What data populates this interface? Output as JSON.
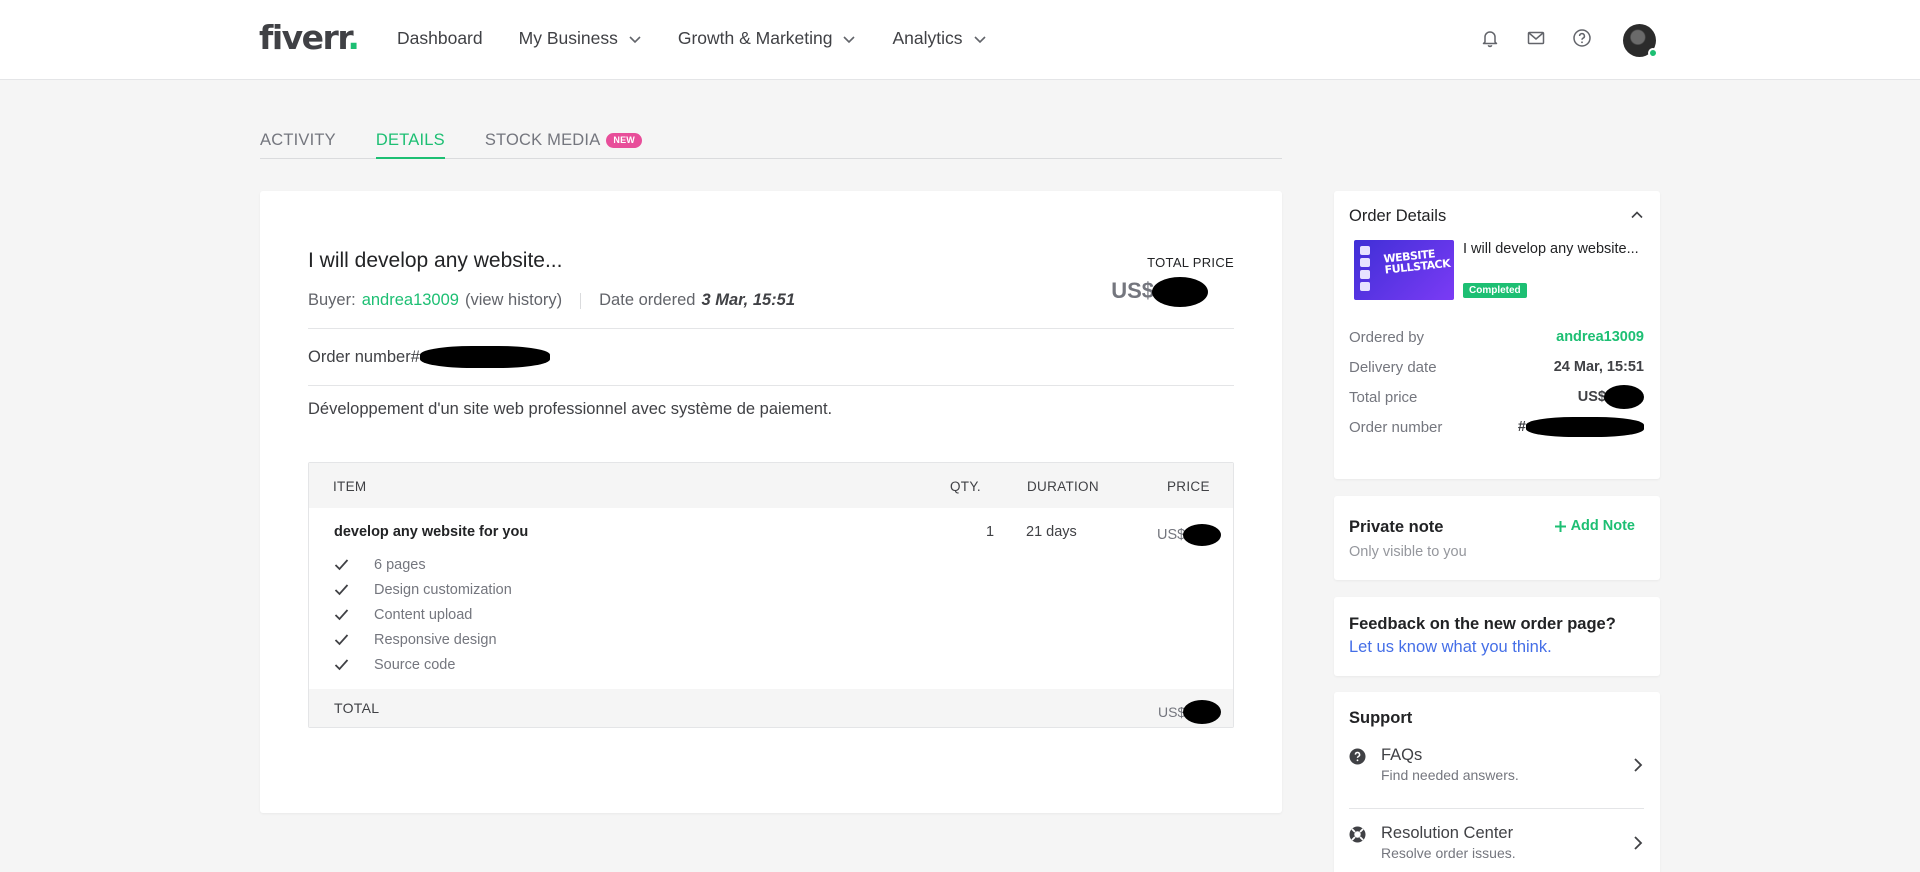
{
  "header": {
    "logo_text": "fiverr",
    "logo_dot": ".",
    "nav": [
      "Dashboard",
      "My Business",
      "Growth & Marketing",
      "Analytics"
    ],
    "icons": [
      "bell-icon",
      "mail-icon",
      "help-icon"
    ]
  },
  "tabs": {
    "activity": "ACTIVITY",
    "details": "DETAILS",
    "stock_media": "STOCK MEDIA",
    "new_badge": "NEW",
    "active": "DETAILS"
  },
  "order": {
    "title": "I will develop any website...",
    "buyer_label": "Buyer:",
    "buyer_name": "andrea13009",
    "view_history": "(view history)",
    "date_label": "Date ordered",
    "date_value": "3 Mar, 15:51",
    "total_price_label": "TOTAL PRICE",
    "currency": "US$",
    "order_number_label": "Order number#",
    "description": "Développement d'un site web professionnel avec système de paiement."
  },
  "table": {
    "headers": {
      "item": "ITEM",
      "qty": "QTY.",
      "duration": "DURATION",
      "price": "PRICE"
    },
    "item": {
      "name": "develop any website for you",
      "qty": "1",
      "duration": "21 days",
      "currency": "US$",
      "features": [
        "6 pages",
        "Design customization",
        "Content upload",
        "Responsive design",
        "Source code"
      ]
    },
    "total_label": "TOTAL",
    "total_currency": "US$"
  },
  "sidebar": {
    "order_details": {
      "title": "Order Details",
      "gig_title": "I will develop any website...",
      "status": "Completed",
      "thumb_text": "WEBSITE FULLSTACK",
      "rows": {
        "ordered_by_label": "Ordered by",
        "ordered_by_value": "andrea13009",
        "delivery_label": "Delivery date",
        "delivery_value": "24 Mar, 15:51",
        "total_label": "Total price",
        "total_currency": "US$",
        "order_number_label": "Order number",
        "order_number_prefix": "#"
      }
    },
    "private_note": {
      "title": "Private note",
      "subtitle": "Only visible to you",
      "add_label": "Add Note"
    },
    "feedback": {
      "title": "Feedback on the new order page?",
      "link": "Let us know what you think."
    },
    "support": {
      "title": "Support",
      "faq_title": "FAQs",
      "faq_sub": "Find needed answers.",
      "res_title": "Resolution Center",
      "res_sub": "Resolve order issues."
    }
  },
  "colors": {
    "accent_green": "#1dbf73",
    "badge_pink": "#e84e9a",
    "link_blue": "#446ee7"
  }
}
